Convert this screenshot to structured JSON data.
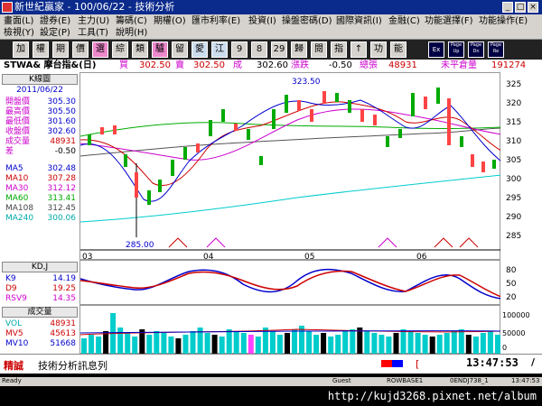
{
  "window": {
    "title": "新世紀贏家 - 100/06/22 - 技術分析",
    "min": "_",
    "max": "□",
    "close": "×"
  },
  "menu_row1": [
    "畫面(L)",
    "證券(E)",
    "主力(U)",
    "籌碼(C)",
    "期權(O)",
    "匯市利率(E)",
    "投資(I)",
    "操盤密碼(D)",
    "國際資訊(I)",
    "金融(C)",
    "功能選擇(F)",
    "功能操作(E)"
  ],
  "menu_row2": [
    "檢視(Y)",
    "設定(P)",
    "工具(T)",
    "說明(H)"
  ],
  "toolbar": [
    "加",
    "權",
    "期",
    "價",
    "選",
    "綜",
    "類",
    "驢",
    "留",
    "愛",
    "江",
    "9",
    "8",
    "29",
    "歸",
    "閱",
    "指",
    "↑",
    "功",
    "能",
    "Ex",
    "Page Up",
    "Page Dn",
    "Page Re"
  ],
  "quote": {
    "symbol": "STWA& 摩台指&(日)",
    "buy_label": "買",
    "buy": "302.50",
    "sell_label": "賣",
    "sell": "302.50",
    "deal_label": "成",
    "deal": "302.60",
    "change_label": "漲跌",
    "change": "-0.50",
    "vol_label": "總張",
    "vol": "48931",
    "oi_label": "未平倉量",
    "oi": "191274"
  },
  "side": {
    "title": "K線圖",
    "date": "2011/06/22",
    "rows": [
      {
        "k": "開盤價",
        "v": "305.30"
      },
      {
        "k": "最高價",
        "v": "305.50"
      },
      {
        "k": "最低價",
        "v": "301.60"
      },
      {
        "k": "收盤價",
        "v": "302.60"
      },
      {
        "k": "成交量",
        "v": "48931"
      },
      {
        "k": "差",
        "v": "-0.50"
      }
    ],
    "ma": [
      {
        "k": "MA5",
        "v": "302.48",
        "color": "#0000cc"
      },
      {
        "k": "MA10",
        "v": "307.28",
        "color": "#cc0000"
      },
      {
        "k": "MA30",
        "v": "312.12",
        "color": "#cc00cc"
      },
      {
        "k": "MA60",
        "v": "313.41",
        "color": "#00aa00"
      },
      {
        "k": "MA108",
        "v": "312.45",
        "color": "#444444"
      },
      {
        "k": "MA240",
        "v": "300.06",
        "color": "#00cccc"
      }
    ]
  },
  "chart_data": {
    "type": "candlestick",
    "yticks": [
      "325",
      "320",
      "315",
      "310",
      "305",
      "300",
      "295",
      "290",
      "285"
    ],
    "xlabels": [
      "03",
      "04",
      "05",
      "06"
    ],
    "high_label": "323.50",
    "low_label": "285.00",
    "ylim": [
      283,
      327
    ]
  },
  "kd": {
    "title": "KD,J",
    "rows": [
      {
        "k": "K9",
        "v": "14.19",
        "color": "#0000cc"
      },
      {
        "k": "D9",
        "v": "19.25",
        "color": "#cc0000"
      },
      {
        "k": "RSV9",
        "v": "14.35",
        "color": "#cc00cc"
      }
    ],
    "yticks": [
      "80",
      "50",
      "20"
    ]
  },
  "volume": {
    "title": "成交量",
    "rows": [
      {
        "k": "VOL",
        "v": "48931",
        "color": "#00aaaa"
      },
      {
        "k": "MV5",
        "v": "45613",
        "color": "#cc0000"
      },
      {
        "k": "MV10",
        "v": "51668",
        "color": "#0000cc"
      }
    ],
    "yticks": [
      "100000",
      "50000",
      "0"
    ]
  },
  "status": {
    "left": "精誠",
    "msg": "技術分析訊息列",
    "bracket": "[",
    "time": "13:47:53",
    "time_bracket": "/"
  },
  "taskbar": {
    "ready": "Ready",
    "guest": "Guest",
    "rowbase": "ROWBASE1",
    "code": "0ENDJ738_1",
    "time": "13:47:53"
  },
  "watermark": "http://kujd3268.pixnet.net/album"
}
